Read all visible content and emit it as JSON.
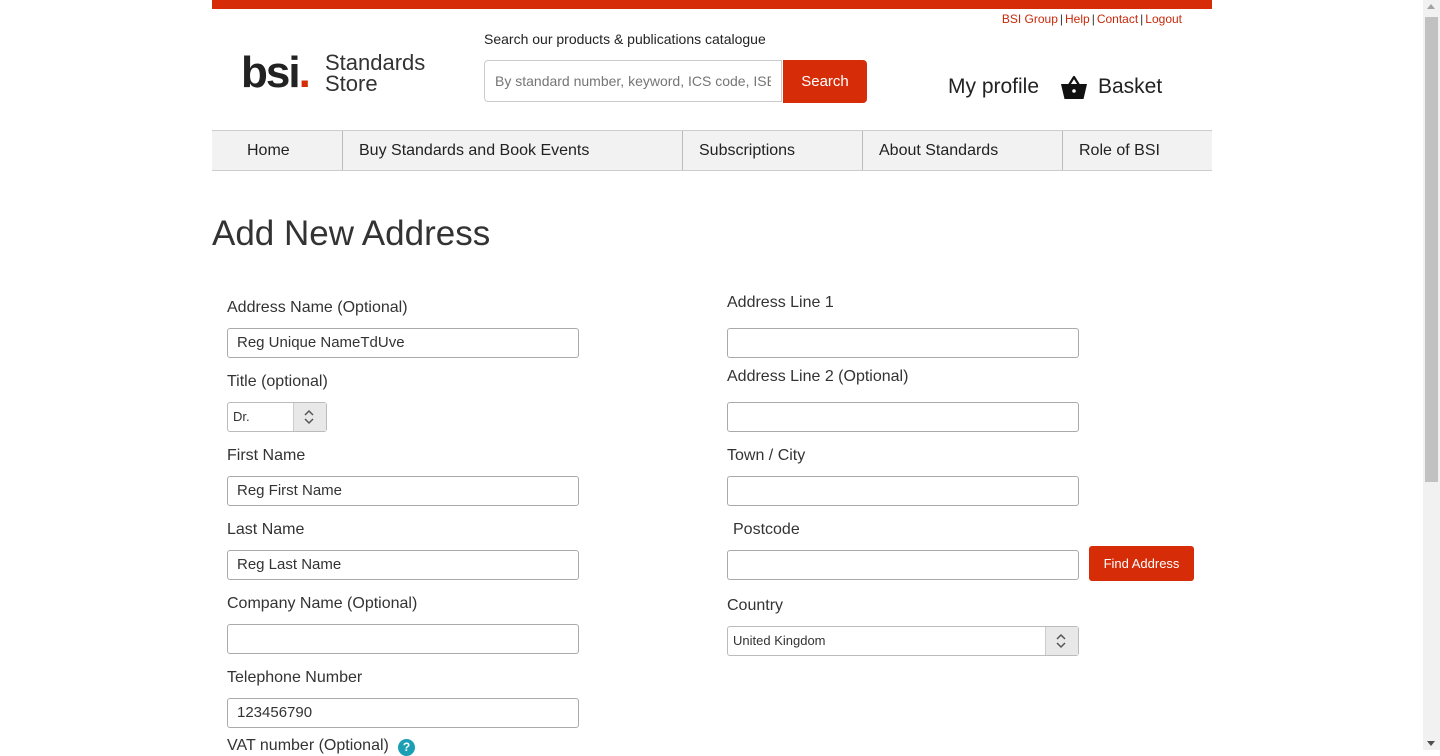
{
  "header": {
    "top_links": [
      "BSI Group",
      "Help",
      "Contact",
      "Logout"
    ],
    "logo_mark": "bsi",
    "logo_dot": ".",
    "logo_line1": "Standards",
    "logo_line2": "Store",
    "search_label": "Search our products & publications catalogue",
    "search_placeholder": "By standard number, keyword, ICS code, ISBN",
    "search_button": "Search",
    "my_profile": "My profile",
    "basket": "Basket",
    "accent_color": "#d62d08"
  },
  "nav": [
    "Home",
    "Buy Standards and Book Events",
    "Subscriptions",
    "About Standards",
    "Role of BSI"
  ],
  "page_title": "Add New Address",
  "form": {
    "address_name_label": "Address Name (Optional)",
    "address_name_value": "Reg Unique NameTdUve",
    "title_label": "Title (optional)",
    "title_value": "Dr.",
    "first_name_label": "First Name",
    "first_name_value": "Reg First Name",
    "last_name_label": "Last Name",
    "last_name_value": "Reg Last Name",
    "company_label": "Company Name (Optional)",
    "company_value": "",
    "telephone_label": "Telephone Number",
    "telephone_value": "123456790",
    "vat_label": "VAT number (Optional)",
    "address1_label": "Address Line 1",
    "address1_value": "",
    "address2_label": "Address Line 2 (Optional)",
    "address2_value": "",
    "town_label": "Town / City",
    "town_value": "",
    "postcode_label": "Postcode",
    "postcode_value": "",
    "find_address_button": "Find Address",
    "country_label": "Country",
    "country_value": "United Kingdom",
    "help_glyph": "?"
  }
}
